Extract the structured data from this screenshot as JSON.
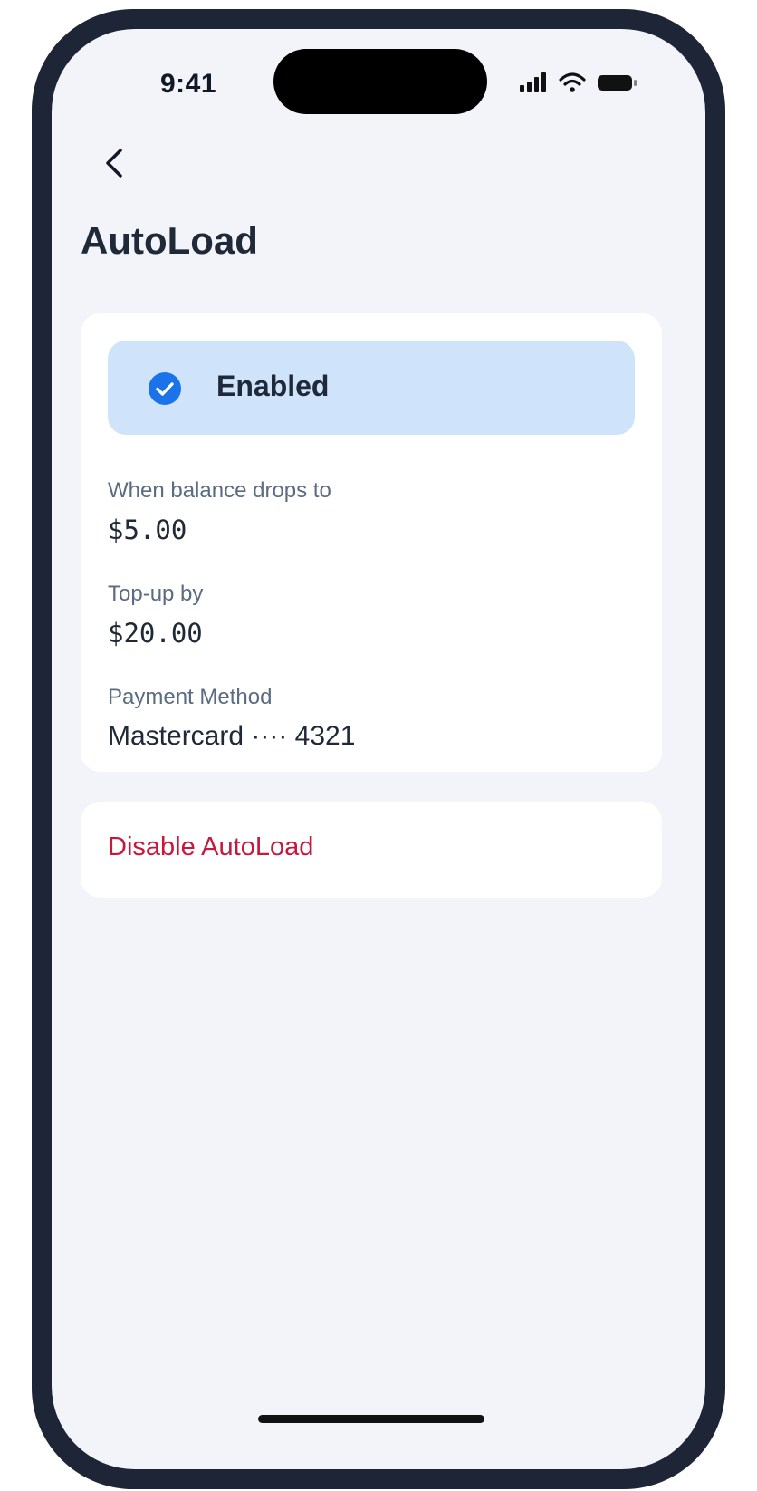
{
  "status_bar": {
    "time": "9:41",
    "icons": [
      "signal-icon",
      "wifi-icon",
      "battery-icon"
    ]
  },
  "nav": {
    "back_icon": "chevron-left-icon"
  },
  "page": {
    "title": "AutoLoad"
  },
  "autoload": {
    "status": {
      "label": "Enabled",
      "icon": "check-circle-icon",
      "enabled": true
    },
    "threshold": {
      "label": "When balance drops to",
      "value": "$5.00"
    },
    "topup": {
      "label": "Top-up by",
      "value": "$20.00"
    },
    "payment": {
      "label": "Payment Method",
      "value": "Mastercard ···· 4321"
    }
  },
  "actions": {
    "disable_label": "Disable AutoLoad"
  },
  "colors": {
    "accent": "#1a73e8",
    "banner_bg": "#cfe3fb",
    "danger": "#c8173d",
    "screen_bg": "#f2f4f9",
    "frame": "#1d2536"
  }
}
